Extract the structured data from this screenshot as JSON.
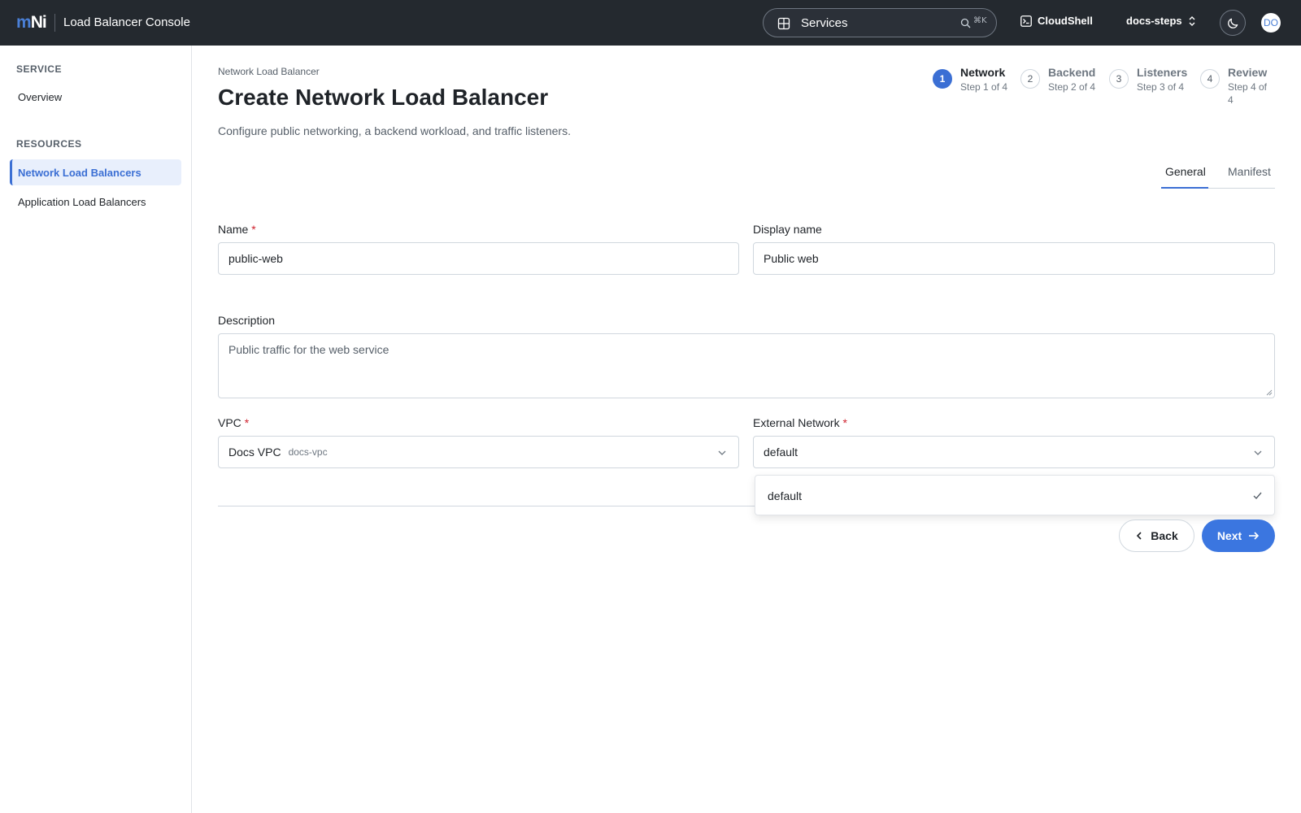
{
  "topbar": {
    "logo_m": "m",
    "logo_ni": "Ni",
    "app_title": "Load Balancer Console",
    "services_label": "Services",
    "search_shortcut": "⌘K",
    "cloudshell_label": "CloudShell",
    "project_label": "docs-steps",
    "avatar_initials": "DO"
  },
  "sidebar": {
    "service_heading": "SERVICE",
    "overview": "Overview",
    "resources_heading": "RESOURCES",
    "items": [
      {
        "label": "Network Load Balancers",
        "active": true
      },
      {
        "label": "Application Load Balancers",
        "active": false
      }
    ]
  },
  "page": {
    "breadcrumb": "Network Load Balancer",
    "title": "Create Network Load Balancer",
    "description": "Configure public networking, a backend workload, and traffic listeners."
  },
  "stepper": [
    {
      "number": "1",
      "label": "Network",
      "sub": "Step 1 of 4",
      "active": true
    },
    {
      "number": "2",
      "label": "Backend",
      "sub": "Step 2 of 4",
      "active": false
    },
    {
      "number": "3",
      "label": "Listeners",
      "sub": "Step 3 of 4",
      "active": false
    },
    {
      "number": "4",
      "label": "Review",
      "sub": "Step 4 of 4",
      "active": false
    }
  ],
  "tabs": [
    {
      "label": "General",
      "active": true
    },
    {
      "label": "Manifest",
      "active": false
    }
  ],
  "form": {
    "name": {
      "label": "Name",
      "required_mark": "*",
      "value": "public-web"
    },
    "display_name": {
      "label": "Display name",
      "value": "Public web"
    },
    "description": {
      "label": "Description",
      "placeholder": "Public traffic for the web service"
    },
    "vpc": {
      "label": "VPC",
      "required_mark": "*",
      "value": "Docs VPC",
      "hint": "docs-vpc"
    },
    "external_network": {
      "label": "External Network",
      "required_mark": "*",
      "value": "default"
    }
  },
  "dropdown": {
    "options": [
      {
        "label": "default",
        "selected": true
      }
    ]
  },
  "actions": {
    "back_label": "Back",
    "next_label": "Next"
  },
  "colors": {
    "accent": "#3b6fd4",
    "topbar": "#24292f",
    "required": "#cf222e"
  }
}
